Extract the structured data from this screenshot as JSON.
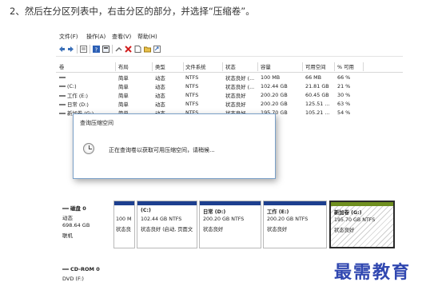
{
  "caption": "2、然后在分区列表中，右击分区的部分，并选择“压缩卷”。",
  "menu": [
    "文件(F)",
    "操作(A)",
    "查看(V)",
    "帮助(H)"
  ],
  "toolbar_icons": [
    "back-arrow-icon",
    "forward-arrow-icon",
    "list-view-icon",
    "help-icon",
    "properties-icon",
    "connect-icon",
    "delete-icon",
    "new-doc-icon",
    "folder-icon",
    "export-icon"
  ],
  "volume_table": {
    "headers": [
      "卷",
      "布局",
      "类型",
      "文件系统",
      "状态",
      "容量",
      "可用空间",
      "% 可用"
    ],
    "rows": [
      [
        "",
        "简单",
        "动态",
        "NTFS",
        "状态良好 (...",
        "100 MB",
        "66 MB",
        "66 %"
      ],
      [
        "(C:)",
        "简单",
        "动态",
        "NTFS",
        "状态良好 (...",
        "102.44 GB",
        "21.81 GB",
        "21 %"
      ],
      [
        "工作 (E:)",
        "简单",
        "动态",
        "NTFS",
        "状态良好",
        "200.20 GB",
        "60.45 GB",
        "30 %"
      ],
      [
        "日常 (D:)",
        "简单",
        "动态",
        "NTFS",
        "状态良好",
        "200.20 GB",
        "125.51 ...",
        "63 %"
      ],
      [
        "新加卷 (G:)",
        "简单",
        "动态",
        "NTFS",
        "状态良好",
        "195.70 GB",
        "105.21 ...",
        "54 %"
      ]
    ]
  },
  "dialog": {
    "title": "查询压缩空间",
    "message": "正在查询卷以获取可用压缩空间，请稍候..."
  },
  "disk0": {
    "name": "磁盘 0",
    "type": "动态",
    "size": "698.64 GB",
    "status": "联机",
    "partitions": [
      {
        "name": "",
        "size": "100 M",
        "status": "状态良"
      },
      {
        "name": "(C:)",
        "size": "102.44 GB NTFS",
        "status": "状态良好 (启动, 页面文"
      },
      {
        "name": "日常  (D:)",
        "size": "200.20 GB NTFS",
        "status": "状态良好"
      },
      {
        "name": "工作  (E:)",
        "size": "200.20 GB NTFS",
        "status": "状态良好"
      },
      {
        "name": "新加卷  (G:)",
        "size": "195.70 GB NTFS",
        "status": "状态良好"
      }
    ]
  },
  "cdrom": {
    "name": "CD-ROM 0",
    "type": "DVD (F:)"
  },
  "watermark": "最需教育",
  "colors": {
    "partition_bar": "#1d3f8f",
    "selected_bar": "#7d9a22",
    "dialog_border": "#7aa0c8",
    "watermark": "#3047b0"
  }
}
